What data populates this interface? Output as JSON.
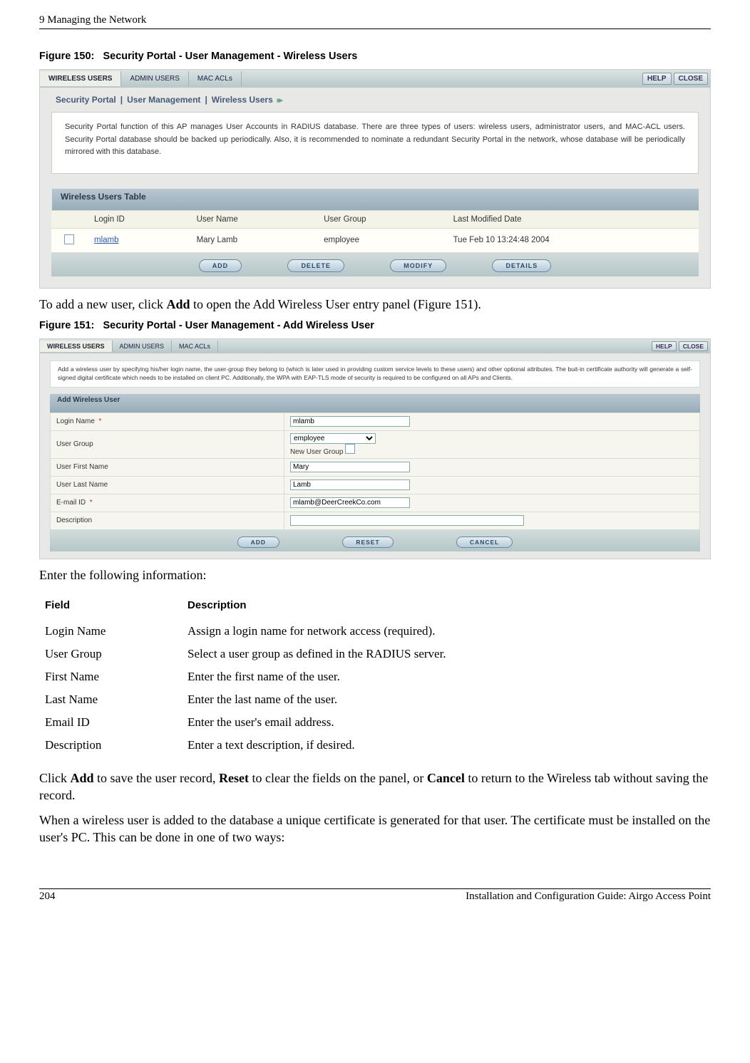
{
  "header": {
    "left": "9 Managing the Network"
  },
  "figures": {
    "f150": {
      "label": "Figure 150:",
      "title": "Security Portal - User Management - Wireless Users"
    },
    "f151": {
      "label": "Figure 151:",
      "title": "Security Portal - User Management - Add Wireless User"
    }
  },
  "tabs": {
    "wireless": "WIRELESS USERS",
    "admin": "ADMIN USERS",
    "mac": "MAC ACLs"
  },
  "topbtns": {
    "help": "HELP",
    "close": "CLOSE"
  },
  "breadcrumb": {
    "a": "Security Portal",
    "b": "User Management",
    "c": "Wireless Users"
  },
  "infobox1": "Security Portal function of this AP manages User Accounts in RADIUS database. There are three types of users: wireless users, administrator users, and MAC-ACL users. Security Portal database should be backed up periodically. Also, it is recommended to nominate a redundant Security Portal in the network, whose database will be periodically mirrored with this database.",
  "section1": "Wireless Users Table",
  "tableHead": {
    "c1": "Login ID",
    "c2": "User Name",
    "c3": "User Group",
    "c4": "Last Modified Date"
  },
  "tableRow1": {
    "login": "mlamb",
    "name": "Mary Lamb",
    "group": "employee",
    "date": "Tue Feb 10 13:24:48 2004"
  },
  "btns1": {
    "add": "ADD",
    "del": "DELETE",
    "mod": "MODIFY",
    "det": "DETAILS"
  },
  "para1a": "To add a new user, click ",
  "para1b": "Add",
  "para1c": " to open the Add Wireless User entry panel (Figure 151).",
  "infobox2": "Add a wireless user by specifying his/her login name, the user-group they belong to (which is later used in providing custom service levels to these users) and other optional attributes. The buit-in certificate authority will generate a self-signed digital certificate which needs to be installed on client PC. Additionally, the WPA with EAP-TLS mode of security is required to be configured on all APs and Clients.",
  "section2": "Add Wireless User",
  "form": {
    "loginLbl": "Login Name",
    "loginVal": "mlamb",
    "groupLbl": "User Group",
    "groupSel": "employee",
    "newGroupLbl": "New User Group",
    "firstLbl": "User First Name",
    "firstVal": "Mary",
    "lastLbl": "User Last Name",
    "lastVal": "Lamb",
    "emailLbl": "E-mail ID",
    "emailVal": "mlamb@DeerCreekCo.com",
    "descLbl": "Description",
    "descVal": ""
  },
  "btns2": {
    "add": "ADD",
    "reset": "RESET",
    "cancel": "CANCEL"
  },
  "para2": "Enter the following information:",
  "fieldsHead": {
    "a": "Field",
    "b": "Description"
  },
  "fields": [
    {
      "f": "Login Name",
      "d": "Assign a login name for network access (required)."
    },
    {
      "f": "User Group",
      "d": "Select a user group as defined in the RADIUS server."
    },
    {
      "f": "First Name",
      "d": "Enter the first name of the user."
    },
    {
      "f": "Last Name",
      "d": "Enter the last name of the user."
    },
    {
      "f": "Email ID",
      "d": "Enter the user's email address."
    },
    {
      "f": "Description",
      "d": "Enter a text description, if desired."
    }
  ],
  "para3a": "Click ",
  "para3b": "Add",
  "para3c": " to save the user record, ",
  "para3d": "Reset",
  "para3e": " to clear the fields on the panel, or ",
  "para3f": "Cancel",
  "para3g": " to return to the Wireless tab without saving the record.",
  "para4": "When a wireless user is added to the database a unique certificate is generated for that user. The certificate must be installed on the user's PC. This can be done in one of two ways:",
  "footer": {
    "left": "204",
    "right": "Installation and Configuration Guide: Airgo Access Point"
  }
}
